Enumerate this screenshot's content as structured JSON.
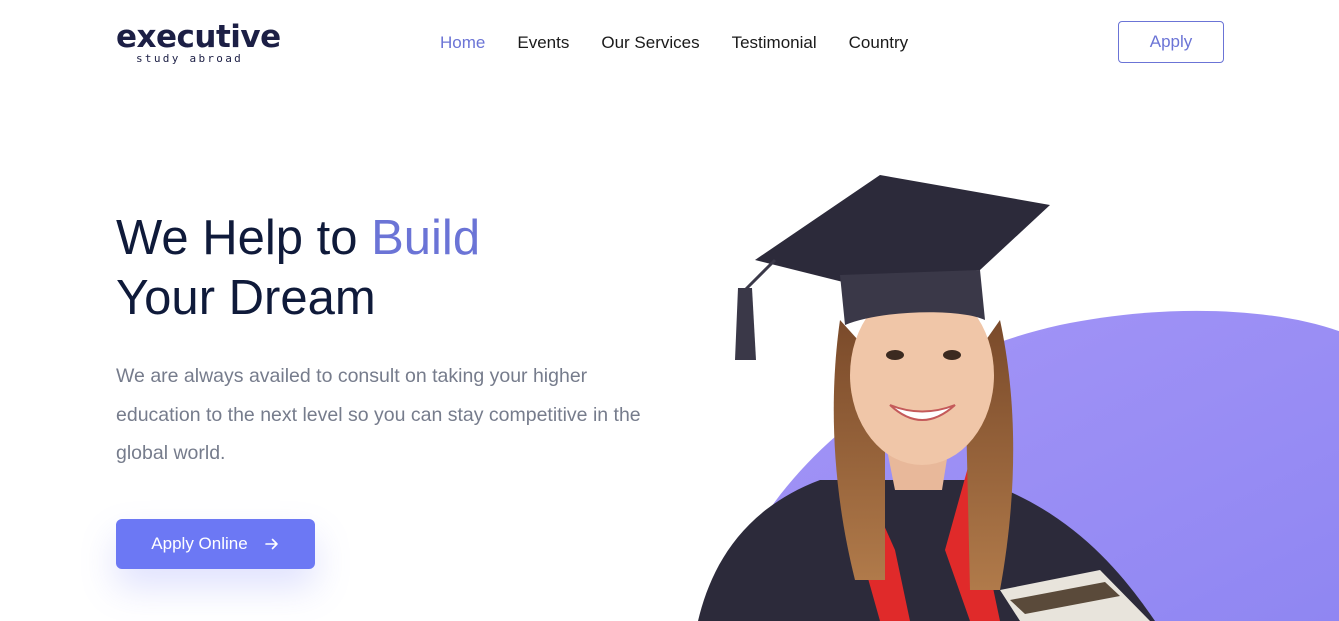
{
  "header": {
    "logo": {
      "main": "executive",
      "sub": "study abroad"
    },
    "nav": [
      {
        "label": "Home",
        "active": true
      },
      {
        "label": "Events",
        "active": false
      },
      {
        "label": "Our Services",
        "active": false
      },
      {
        "label": "Testimonial",
        "active": false
      },
      {
        "label": "Country",
        "active": false
      }
    ],
    "apply_label": "Apply"
  },
  "hero": {
    "title_part1": "We Help to ",
    "title_accent": "Build",
    "title_part2": "Your Dream",
    "description": "We are always availed to consult on taking your higher education to the next level so you can stay competitive in the global world.",
    "cta_label": "Apply Online",
    "cta_icon": "arrow-right-icon"
  },
  "colors": {
    "accent": "#6b74d6",
    "cta_bg": "#6c78f4",
    "blob": "#9a8cf5",
    "heading": "#0f1a3a",
    "body_text": "#767c8c"
  }
}
